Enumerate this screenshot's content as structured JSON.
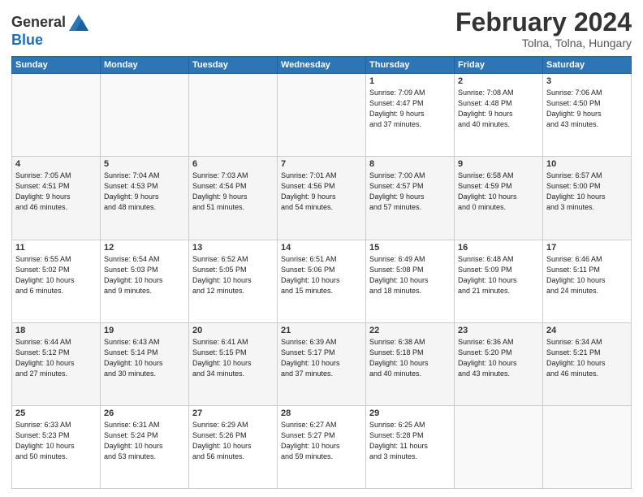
{
  "header": {
    "logo_general": "General",
    "logo_blue": "Blue",
    "title": "February 2024",
    "location": "Tolna, Tolna, Hungary"
  },
  "weekdays": [
    "Sunday",
    "Monday",
    "Tuesday",
    "Wednesday",
    "Thursday",
    "Friday",
    "Saturday"
  ],
  "weeks": [
    [
      {
        "day": "",
        "info": ""
      },
      {
        "day": "",
        "info": ""
      },
      {
        "day": "",
        "info": ""
      },
      {
        "day": "",
        "info": ""
      },
      {
        "day": "1",
        "info": "Sunrise: 7:09 AM\nSunset: 4:47 PM\nDaylight: 9 hours\nand 37 minutes."
      },
      {
        "day": "2",
        "info": "Sunrise: 7:08 AM\nSunset: 4:48 PM\nDaylight: 9 hours\nand 40 minutes."
      },
      {
        "day": "3",
        "info": "Sunrise: 7:06 AM\nSunset: 4:50 PM\nDaylight: 9 hours\nand 43 minutes."
      }
    ],
    [
      {
        "day": "4",
        "info": "Sunrise: 7:05 AM\nSunset: 4:51 PM\nDaylight: 9 hours\nand 46 minutes."
      },
      {
        "day": "5",
        "info": "Sunrise: 7:04 AM\nSunset: 4:53 PM\nDaylight: 9 hours\nand 48 minutes."
      },
      {
        "day": "6",
        "info": "Sunrise: 7:03 AM\nSunset: 4:54 PM\nDaylight: 9 hours\nand 51 minutes."
      },
      {
        "day": "7",
        "info": "Sunrise: 7:01 AM\nSunset: 4:56 PM\nDaylight: 9 hours\nand 54 minutes."
      },
      {
        "day": "8",
        "info": "Sunrise: 7:00 AM\nSunset: 4:57 PM\nDaylight: 9 hours\nand 57 minutes."
      },
      {
        "day": "9",
        "info": "Sunrise: 6:58 AM\nSunset: 4:59 PM\nDaylight: 10 hours\nand 0 minutes."
      },
      {
        "day": "10",
        "info": "Sunrise: 6:57 AM\nSunset: 5:00 PM\nDaylight: 10 hours\nand 3 minutes."
      }
    ],
    [
      {
        "day": "11",
        "info": "Sunrise: 6:55 AM\nSunset: 5:02 PM\nDaylight: 10 hours\nand 6 minutes."
      },
      {
        "day": "12",
        "info": "Sunrise: 6:54 AM\nSunset: 5:03 PM\nDaylight: 10 hours\nand 9 minutes."
      },
      {
        "day": "13",
        "info": "Sunrise: 6:52 AM\nSunset: 5:05 PM\nDaylight: 10 hours\nand 12 minutes."
      },
      {
        "day": "14",
        "info": "Sunrise: 6:51 AM\nSunset: 5:06 PM\nDaylight: 10 hours\nand 15 minutes."
      },
      {
        "day": "15",
        "info": "Sunrise: 6:49 AM\nSunset: 5:08 PM\nDaylight: 10 hours\nand 18 minutes."
      },
      {
        "day": "16",
        "info": "Sunrise: 6:48 AM\nSunset: 5:09 PM\nDaylight: 10 hours\nand 21 minutes."
      },
      {
        "day": "17",
        "info": "Sunrise: 6:46 AM\nSunset: 5:11 PM\nDaylight: 10 hours\nand 24 minutes."
      }
    ],
    [
      {
        "day": "18",
        "info": "Sunrise: 6:44 AM\nSunset: 5:12 PM\nDaylight: 10 hours\nand 27 minutes."
      },
      {
        "day": "19",
        "info": "Sunrise: 6:43 AM\nSunset: 5:14 PM\nDaylight: 10 hours\nand 30 minutes."
      },
      {
        "day": "20",
        "info": "Sunrise: 6:41 AM\nSunset: 5:15 PM\nDaylight: 10 hours\nand 34 minutes."
      },
      {
        "day": "21",
        "info": "Sunrise: 6:39 AM\nSunset: 5:17 PM\nDaylight: 10 hours\nand 37 minutes."
      },
      {
        "day": "22",
        "info": "Sunrise: 6:38 AM\nSunset: 5:18 PM\nDaylight: 10 hours\nand 40 minutes."
      },
      {
        "day": "23",
        "info": "Sunrise: 6:36 AM\nSunset: 5:20 PM\nDaylight: 10 hours\nand 43 minutes."
      },
      {
        "day": "24",
        "info": "Sunrise: 6:34 AM\nSunset: 5:21 PM\nDaylight: 10 hours\nand 46 minutes."
      }
    ],
    [
      {
        "day": "25",
        "info": "Sunrise: 6:33 AM\nSunset: 5:23 PM\nDaylight: 10 hours\nand 50 minutes."
      },
      {
        "day": "26",
        "info": "Sunrise: 6:31 AM\nSunset: 5:24 PM\nDaylight: 10 hours\nand 53 minutes."
      },
      {
        "day": "27",
        "info": "Sunrise: 6:29 AM\nSunset: 5:26 PM\nDaylight: 10 hours\nand 56 minutes."
      },
      {
        "day": "28",
        "info": "Sunrise: 6:27 AM\nSunset: 5:27 PM\nDaylight: 10 hours\nand 59 minutes."
      },
      {
        "day": "29",
        "info": "Sunrise: 6:25 AM\nSunset: 5:28 PM\nDaylight: 11 hours\nand 3 minutes."
      },
      {
        "day": "",
        "info": ""
      },
      {
        "day": "",
        "info": ""
      }
    ]
  ]
}
